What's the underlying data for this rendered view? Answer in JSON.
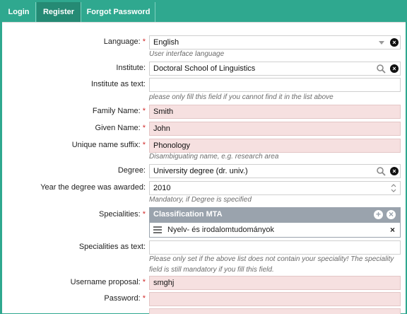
{
  "tabs": [
    {
      "label": "Login"
    },
    {
      "label": "Register"
    },
    {
      "label": "Forgot Password"
    }
  ],
  "form": {
    "language": {
      "label": "Language:",
      "value": "English",
      "hint": "User interface language"
    },
    "institute": {
      "label": "Institute:",
      "value": "Doctoral School of Linguistics"
    },
    "institute_text": {
      "label": "Institute as text:",
      "value": "",
      "hint": "please only fill this field if you cannot find it in the list above"
    },
    "family_name": {
      "label": "Family Name:",
      "value": "Smith"
    },
    "given_name": {
      "label": "Given Name:",
      "value": "John"
    },
    "unique_suffix": {
      "label": "Unique name suffix:",
      "value": "Phonology",
      "hint": "Disambiguating name, e.g. research area"
    },
    "degree": {
      "label": "Degree:",
      "value": "University degree (dr. univ.)"
    },
    "degree_year": {
      "label": "Year the degree was awarded:",
      "value": "2010",
      "hint": "Mandatory, if Degree is specified"
    },
    "specialities": {
      "label": "Specialities:",
      "header": "Classification MTA",
      "item": "Nyelv- és irodalomtudományok"
    },
    "specialities_text": {
      "label": "Specialities as text:",
      "value": "",
      "hint": "Please only set if the above list does not contain your speciality! The speciality field is still mandatory if you fill this field."
    },
    "username": {
      "label": "Username proposal:",
      "value": "smghj"
    },
    "password": {
      "label": "Password:",
      "value": ""
    }
  },
  "required_marker": "*",
  "colors": {
    "accent": "#2fa88f",
    "required_field": "#f6e0e0",
    "spec_header": "#9aa3ad"
  }
}
